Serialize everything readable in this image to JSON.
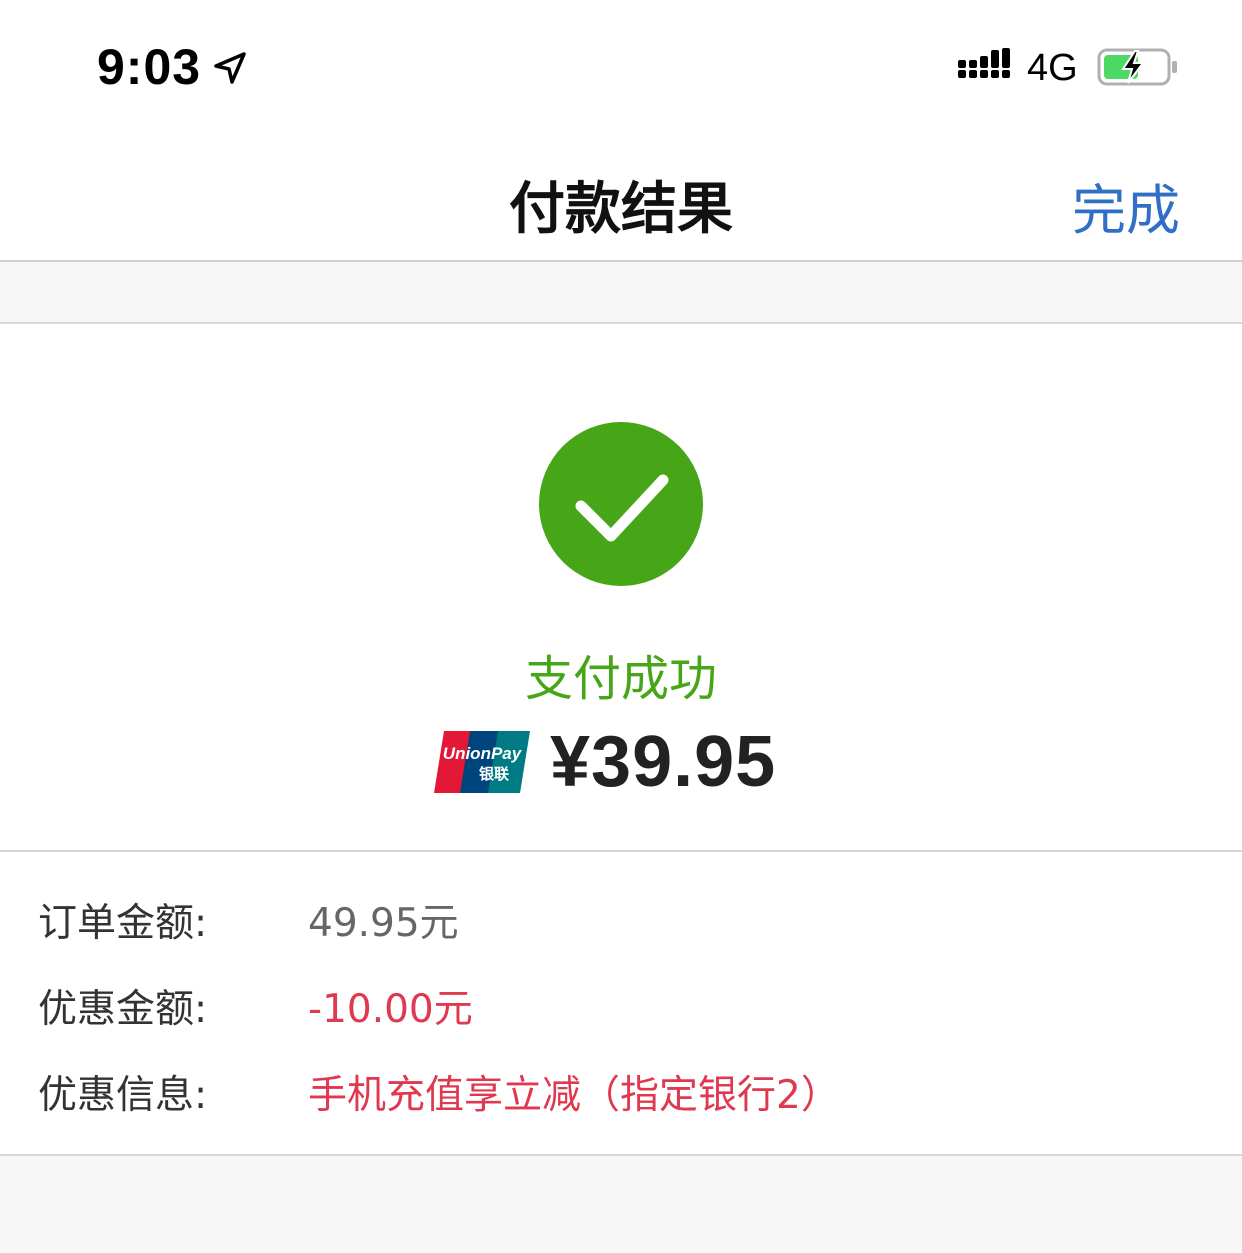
{
  "status_bar": {
    "time": "9:03",
    "network": "4G"
  },
  "nav": {
    "title": "付款结果",
    "done_label": "完成"
  },
  "result": {
    "status_text": "支付成功",
    "status_color": "#46a617",
    "amount": "¥39.95"
  },
  "details": [
    {
      "label": "订单金额:",
      "value": "49.95元",
      "value_color": "#666666"
    },
    {
      "label": "优惠金额:",
      "value": "-10.00元",
      "value_color": "#e0384e"
    },
    {
      "label": "优惠信息:",
      "value": "手机充值享立减（指定银行2）",
      "value_color": "#e0384e"
    }
  ],
  "colors": {
    "accent": "#2f6fc6",
    "success": "#46a617",
    "discount": "#e0384e"
  }
}
